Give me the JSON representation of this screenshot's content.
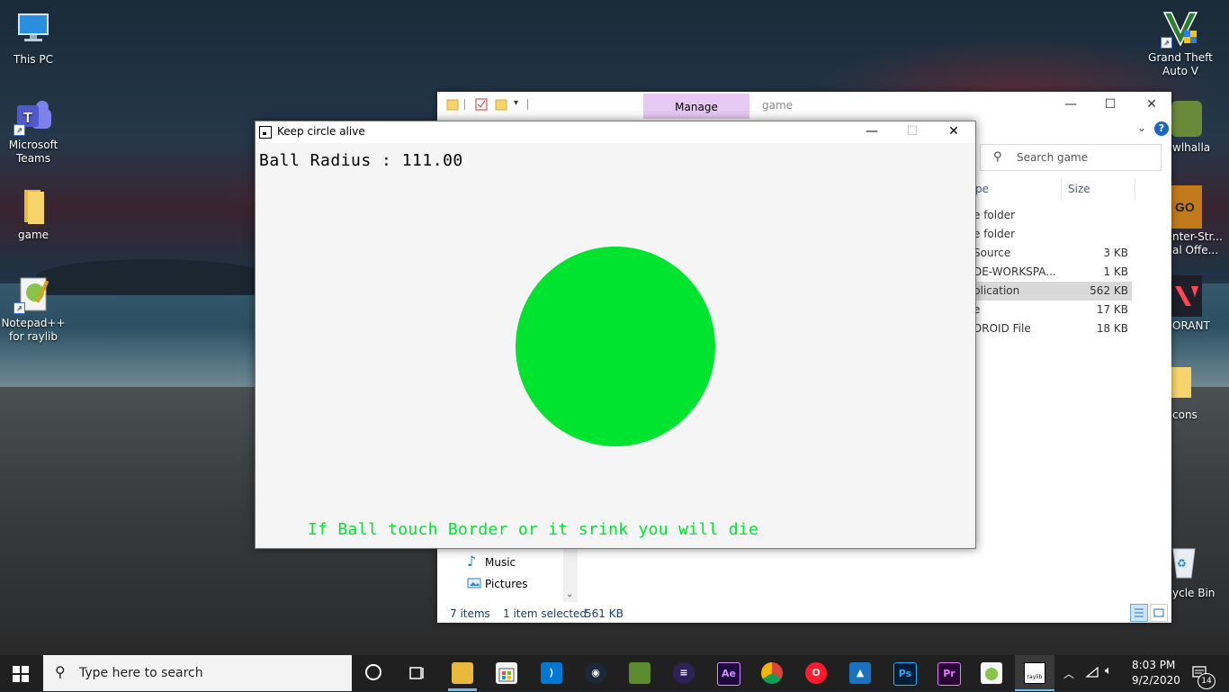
{
  "desktop": {
    "icons": [
      {
        "label": "This PC",
        "icon": "monitor-icon"
      },
      {
        "label": "Microsoft Teams",
        "icon": "teams-icon"
      },
      {
        "label": "game",
        "icon": "folder-icon"
      },
      {
        "label": "Notepad++ for raylib",
        "icon": "notepadpp-icon"
      },
      {
        "label": "Grand Theft Auto V",
        "icon": "gta-icon"
      }
    ],
    "right_partial_labels": [
      "wlhalla",
      "nter-Str...",
      "al Offe...",
      "ORANT",
      "cons",
      "ycle Bin"
    ]
  },
  "explorer": {
    "tab_manage": "Manage",
    "title": "game",
    "search_placeholder": "Search game",
    "columns": {
      "type": "pe",
      "size": "Size"
    },
    "rows": [
      {
        "type": "e folder",
        "size": "",
        "selected": false
      },
      {
        "type": "e folder",
        "size": "",
        "selected": false
      },
      {
        "type": "Source",
        "size": "3 KB",
        "selected": false
      },
      {
        "type": "DE-WORKSPA...",
        "size": "1 KB",
        "selected": false
      },
      {
        "type": "plication",
        "size": "562 KB",
        "selected": true
      },
      {
        "type": "e",
        "size": "17 KB",
        "selected": false
      },
      {
        "type": "DROID File",
        "size": "18 KB",
        "selected": false
      }
    ],
    "nav": [
      {
        "label": "Music",
        "icon": "music-icon"
      },
      {
        "label": "Pictures",
        "icon": "pictures-icon"
      }
    ],
    "status": {
      "items": "7 items",
      "selected": "1 item selected",
      "size": "561 KB"
    }
  },
  "game_window": {
    "title": "Keep circle alive",
    "radius_text": "Ball Radius : 111.00",
    "warning": "If Ball touch Border or it srink you will die",
    "ball_color": "#00e430"
  },
  "taskbar": {
    "search_placeholder": "Type here to search",
    "apps": [
      "task-view-icon",
      "file-explorer-icon",
      "store-icon",
      "vscode-icon",
      "steam-icon",
      "minecraft-icon",
      "eclipse-icon",
      "after-effects-icon",
      "chrome-icon",
      "opera-icon",
      "affinity-icon",
      "photoshop-icon",
      "premiere-icon",
      "notepadpp-icon",
      "raylib-icon"
    ],
    "raylib_label": "raylib",
    "ae_label": "Ae",
    "ps_label": "Ps",
    "pr_label": "Pr",
    "time": "8:03 PM",
    "date": "9/2/2020",
    "notification_count": "14"
  }
}
